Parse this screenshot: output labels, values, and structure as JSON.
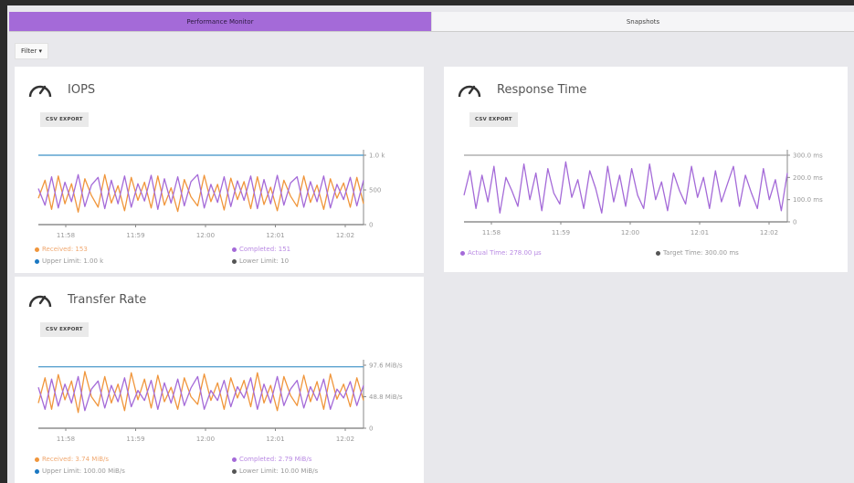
{
  "tabs": [
    {
      "label": "Performance Monitor",
      "active": true
    },
    {
      "label": "Snapshots",
      "active": false
    }
  ],
  "filter": {
    "label": "Filter ▾"
  },
  "colors": {
    "accent": "#a46ad8",
    "received": "#f0963c",
    "completed": "#a46ad8",
    "upper": "#1a78c2",
    "lower": "#555555",
    "limit_line": "#5ba3cf"
  },
  "cards": {
    "iops": {
      "title": "IOPS",
      "icon": "gauge-icon",
      "csv_label": "CSV EXPORT",
      "legend": {
        "received": "Received: 153",
        "completed": "Completed: 151",
        "upper": "Upper Limit: 1.00 k",
        "lower": "Lower Limit: 10"
      }
    },
    "response": {
      "title": "Response Time",
      "icon": "gauge-icon",
      "csv_label": "CSV EXPORT",
      "legend": {
        "actual": "Actual Time: 278.00 μs",
        "target": "Target Time: 300.00 ms"
      }
    },
    "transfer": {
      "title": "Transfer Rate",
      "icon": "gauge-icon",
      "csv_label": "CSV EXPORT",
      "legend": {
        "received": "Received: 3.74 MiB/s",
        "completed": "Completed: 2.79 MiB/s",
        "upper": "Upper Limit: 100.00 MiB/s",
        "lower": "Lower Limit: 10.00 MiB/s"
      }
    }
  },
  "chart_data": [
    {
      "type": "line",
      "x_ticks": [
        "11:58",
        "11:59",
        "12:00",
        "12:01",
        "12:02"
      ],
      "y_ticks": [
        "0",
        "500",
        "1.0 k"
      ],
      "ylim": [
        0,
        1000
      ],
      "limits": {
        "upper": 1000,
        "lower": 10
      },
      "series": [
        {
          "name": "Received",
          "values": [
            380,
            640,
            220,
            700,
            300,
            590,
            180,
            660,
            420,
            250,
            720,
            310,
            560,
            200,
            680,
            350,
            610,
            240,
            700,
            280,
            530,
            190,
            650,
            400,
            270,
            710,
            330,
            580,
            210,
            670,
            360,
            620,
            230,
            690,
            290,
            540,
            200,
            640,
            410,
            260,
            700,
            320,
            570,
            220,
            660,
            380,
            600,
            250,
            680,
            300
          ]
        },
        {
          "name": "Completed",
          "values": [
            520,
            280,
            690,
            240,
            610,
            330,
            720,
            260,
            570,
            680,
            230,
            640,
            300,
            700,
            250,
            590,
            340,
            710,
            220,
            660,
            310,
            690,
            270,
            620,
            720,
            240,
            580,
            320,
            690,
            260,
            630,
            350,
            700,
            230,
            650,
            300,
            710,
            280,
            600,
            690,
            250,
            620,
            330,
            700,
            240,
            580,
            360,
            680,
            270,
            640
          ]
        }
      ]
    },
    {
      "type": "line",
      "x_ticks": [
        "11:58",
        "11:59",
        "12:00",
        "12:01",
        "12:02"
      ],
      "y_ticks": [
        "0",
        "100.0 ms",
        "200.0 ms",
        "300.0 ms"
      ],
      "ylim": [
        0,
        300
      ],
      "limits": {
        "target": 300
      },
      "series": [
        {
          "name": "Actual Time",
          "values": [
            120,
            230,
            60,
            210,
            90,
            250,
            40,
            200,
            140,
            70,
            260,
            100,
            220,
            50,
            240,
            130,
            80,
            270,
            110,
            190,
            60,
            230,
            150,
            40,
            250,
            90,
            210,
            70,
            240,
            120,
            60,
            260,
            100,
            180,
            50,
            220,
            140,
            80,
            250,
            110,
            200,
            60,
            230,
            90,
            170,
            250,
            70,
            210,
            130,
            60,
            240,
            100,
            190,
            50,
            220
          ]
        }
      ]
    },
    {
      "type": "line",
      "x_ticks": [
        "11:58",
        "11:59",
        "12:00",
        "12:01",
        "12:02"
      ],
      "y_ticks": [
        "0",
        "48.8 MiB/s",
        "97.6 MiB/s"
      ],
      "ylim": [
        0,
        100
      ],
      "limits": {
        "upper": 97.6,
        "lower": 0
      },
      "series": [
        {
          "name": "Received",
          "values": [
            40,
            80,
            30,
            85,
            45,
            75,
            25,
            90,
            50,
            35,
            82,
            40,
            70,
            28,
            88,
            45,
            78,
            32,
            84,
            42,
            65,
            30,
            80,
            50,
            38,
            86,
            44,
            72,
            30,
            80,
            48,
            76,
            34,
            88,
            40,
            68,
            28,
            82,
            52,
            36,
            84,
            42,
            74,
            30,
            86,
            46,
            70,
            34,
            80,
            44
          ]
        },
        {
          "name": "Completed",
          "values": [
            65,
            30,
            78,
            35,
            70,
            40,
            82,
            28,
            62,
            75,
            32,
            68,
            42,
            80,
            34,
            60,
            44,
            76,
            30,
            72,
            40,
            78,
            36,
            64,
            82,
            30,
            60,
            44,
            76,
            34,
            66,
            48,
            80,
            30,
            70,
            40,
            82,
            36,
            62,
            76,
            32,
            66,
            44,
            78,
            30,
            62,
            48,
            74,
            36,
            68
          ]
        }
      ]
    }
  ]
}
